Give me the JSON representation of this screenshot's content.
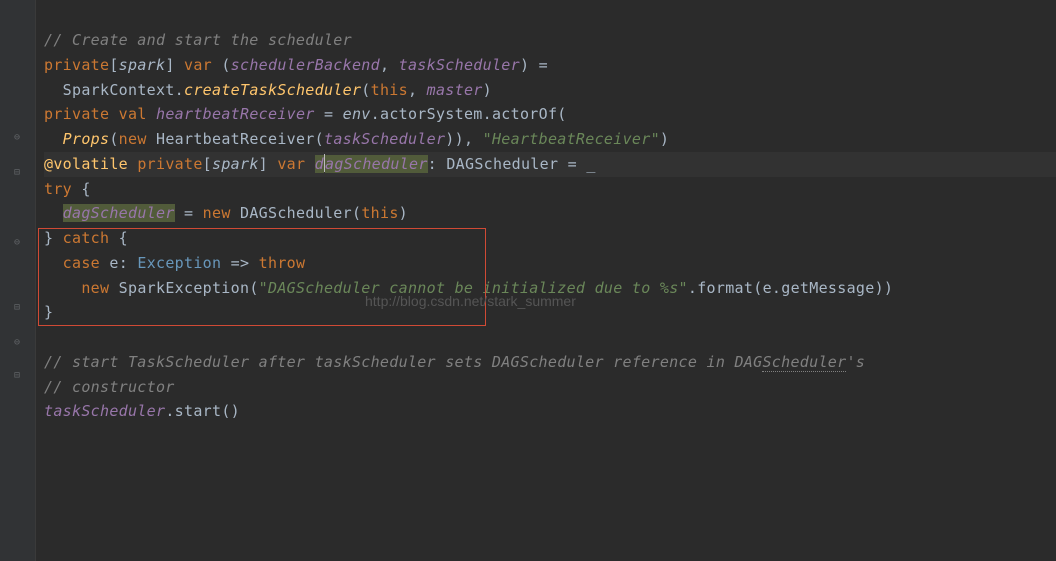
{
  "lines": {
    "l1_comment": "// Create and start the scheduler",
    "l2": {
      "private": "private",
      "spark": "spark",
      "var": "var",
      "schedulerBackend": "schedulerBackend",
      "taskScheduler": "taskScheduler"
    },
    "l3": {
      "sparkContext": "SparkContext",
      "createTaskScheduler": "createTaskScheduler",
      "this": "this",
      "master": "master"
    },
    "l4": {
      "private": "private",
      "val": "val",
      "heartbeatReceiver": "heartbeatReceiver",
      "env": "env",
      "actorSystem": "actorSystem",
      "actorOf": "actorOf"
    },
    "l5": {
      "props": "Props",
      "new": "new",
      "heartbeatReceiver": "HeartbeatReceiver",
      "taskScheduler": "taskScheduler",
      "str": "\"HeartbeatReceiver\""
    },
    "l6": {
      "volatile": "@volatile",
      "private": "private",
      "spark": "spark",
      "var": "var",
      "d": "d",
      "agScheduler": "agScheduler",
      "dagSchedulerType": "DAGScheduler",
      "under": "_"
    },
    "l7": {
      "try": "try"
    },
    "l8": {
      "dagScheduler": "dagScheduler",
      "new": "new",
      "dagSchedulerType": "DAGScheduler",
      "this": "this"
    },
    "l9": {
      "catch": "catch"
    },
    "l10": {
      "case": "case",
      "e": "e",
      "exception": "Exception",
      "throw": "throw"
    },
    "l11": {
      "new": "new",
      "sparkException": "SparkException",
      "str": "\"DAGScheduler cannot be initialized due to %s\"",
      "format": "format",
      "e": "e",
      "getMessage": "getMessage"
    },
    "l14_comment_a": "// start TaskScheduler after taskScheduler sets DAGScheduler reference in DAG",
    "l14_comment_b": "Scheduler",
    "l14_comment_c": "'s",
    "l15_comment": "// constructor",
    "l16": {
      "taskScheduler": "taskScheduler",
      "start": "start"
    }
  },
  "watermark": "http://blog.csdn.net/stark_summer",
  "gutter_icons": {
    "g1": "⊖",
    "g2": "⊟",
    "g3": "⊖",
    "g4": "⊟",
    "g5": "⊖",
    "g6": "⊟"
  }
}
